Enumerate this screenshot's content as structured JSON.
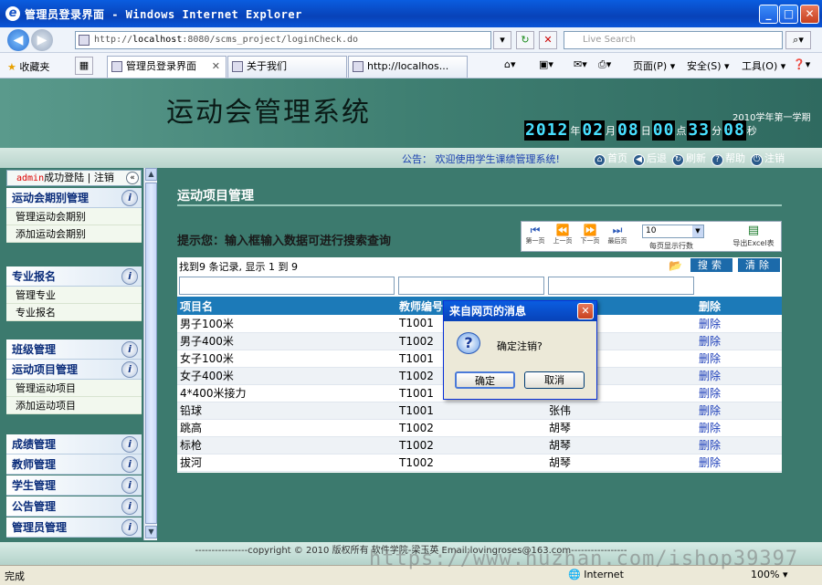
{
  "window": {
    "title": "管理员登录界面 - Windows Internet Explorer",
    "min": "_",
    "max": "□",
    "close": "✕"
  },
  "address": {
    "url_prefix": "http://",
    "url_host": "localhost",
    "url_rest": ":8080/scms_project/loginCheck.do",
    "search_placeholder": "Live Search"
  },
  "favorites": {
    "label": "收藏夹"
  },
  "tabs": [
    {
      "label": "管理员登录界面",
      "close": "✕"
    },
    {
      "label": "关于我们"
    },
    {
      "label": "http://localhos..."
    }
  ],
  "commands": {
    "page": "页面(P) ▾",
    "security": "安全(S) ▾",
    "tools": "工具(O) ▾"
  },
  "header": {
    "system_name": "运动会管理系统",
    "term": "2010学年第一学期",
    "clock": [
      {
        "d": "2012",
        "u": "年"
      },
      {
        "d": "02",
        "u": "月"
      },
      {
        "d": "08",
        "u": "日"
      },
      {
        "d": "00",
        "u": "点"
      },
      {
        "d": "33",
        "u": "分"
      },
      {
        "d": "08",
        "u": "秒"
      }
    ]
  },
  "notice": {
    "label": "公告：",
    "text": "欢迎使用学生课绩管理系统!"
  },
  "topnav": [
    {
      "icon": "home-icon",
      "glyph": "⌂",
      "label": "首页"
    },
    {
      "icon": "back-icon",
      "glyph": "◀",
      "label": "后退"
    },
    {
      "icon": "refresh-icon",
      "glyph": "↻",
      "label": "刷新"
    },
    {
      "icon": "help-icon",
      "glyph": "?",
      "label": "帮助"
    },
    {
      "icon": "logout-icon",
      "glyph": "⏻",
      "label": "注销"
    }
  ],
  "sidebar": {
    "user": "admin",
    "login_text": "成功登陆",
    "separator": "|",
    "logout": "注销",
    "groups": [
      {
        "title": "运动会期别管理",
        "items": [
          "管理运动会期别",
          "添加运动会期别"
        ]
      },
      {
        "title": "专业报名",
        "items": [
          "管理专业",
          "专业报名"
        ]
      },
      {
        "title": "班级管理",
        "items": []
      },
      {
        "title": "运动项目管理",
        "items": [
          "管理运动项目",
          "添加运动项目"
        ]
      },
      {
        "title": "成绩管理",
        "items": []
      },
      {
        "title": "教师管理",
        "items": []
      },
      {
        "title": "学生管理",
        "items": []
      },
      {
        "title": "公告管理",
        "items": []
      },
      {
        "title": "管理员管理",
        "items": []
      }
    ]
  },
  "main": {
    "title": "运动项目管理",
    "tip": "提示您：输入框输入数据可进行搜索查询",
    "toolbar": {
      "first": "第一页",
      "prev": "上一页",
      "next": "下一页",
      "last": "最后页",
      "page_size": "10",
      "page_size_label": "每页显示行数",
      "export": "导出Excel表"
    },
    "found": "找到9 条记录, 显示 1 到 9",
    "search": "搜索",
    "clear": "清除",
    "columns": [
      "项目名",
      "教师编号",
      "",
      "删除"
    ],
    "rows": [
      {
        "name": "男子100米",
        "tid": "T1001",
        "teacher": "",
        "del": "删除"
      },
      {
        "name": "男子400米",
        "tid": "T1002",
        "teacher": "",
        "del": "删除"
      },
      {
        "name": "女子100米",
        "tid": "T1001",
        "teacher": "",
        "del": "删除"
      },
      {
        "name": "女子400米",
        "tid": "T1002",
        "teacher": "",
        "del": "删除"
      },
      {
        "name": "4*400米接力",
        "tid": "T1001",
        "teacher": "",
        "del": "删除"
      },
      {
        "name": "铅球",
        "tid": "T1001",
        "teacher": "张伟",
        "del": "删除"
      },
      {
        "name": "跳高",
        "tid": "T1002",
        "teacher": "胡琴",
        "del": "删除"
      },
      {
        "name": "标枪",
        "tid": "T1002",
        "teacher": "胡琴",
        "del": "删除"
      },
      {
        "name": "拔河",
        "tid": "T1002",
        "teacher": "胡琴",
        "del": "删除"
      }
    ]
  },
  "footer": {
    "text": "----------------copyright © 2010 版权所有 软件学院-梁玉英 Email:lovingroses@163.com-----------------"
  },
  "dialog": {
    "title": "来自网页的消息",
    "message": "确定注销?",
    "ok": "确定",
    "cancel": "取消"
  },
  "status": {
    "done": "完成",
    "zone": "Internet",
    "zoom": "100%"
  },
  "watermark": "https://www.huzhan.com/ishop39397"
}
